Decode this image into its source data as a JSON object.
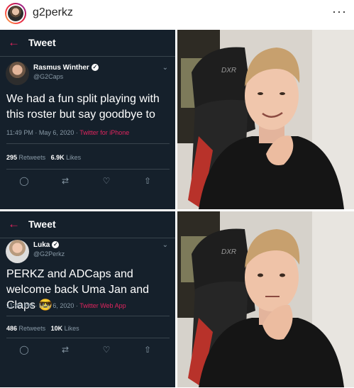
{
  "post": {
    "username": "g2perkz",
    "more_icon": "ellipsis-icon"
  },
  "tweet1": {
    "header": "Tweet",
    "name": "Rasmus Winther",
    "handle": "@G2Caps",
    "text": "We had a fun split playing with this roster but say goodbye to",
    "time": "11:49 PM · May 6, 2020 · ",
    "source": "Twitter for iPhone",
    "retweets": "295",
    "retweets_label": "Retweets",
    "likes": "6.9K",
    "likes_label": "Likes"
  },
  "tweet2": {
    "header": "Tweet",
    "name": "Luka",
    "handle": "@G2Perkz",
    "text": "PERKZ and ADCaps and welcome back Uma Jan and Claps 😎",
    "time": "11:49 PM · May 6, 2020 · ",
    "source": "Twitter Web App",
    "retweets": "486",
    "retweets_label": "Retweets",
    "likes": "10K",
    "likes_label": "Likes"
  },
  "colors": {
    "tweet_bg": "#15202b",
    "accent": "#e0245e",
    "muted": "#8899a6"
  },
  "chair_text": "DXR"
}
